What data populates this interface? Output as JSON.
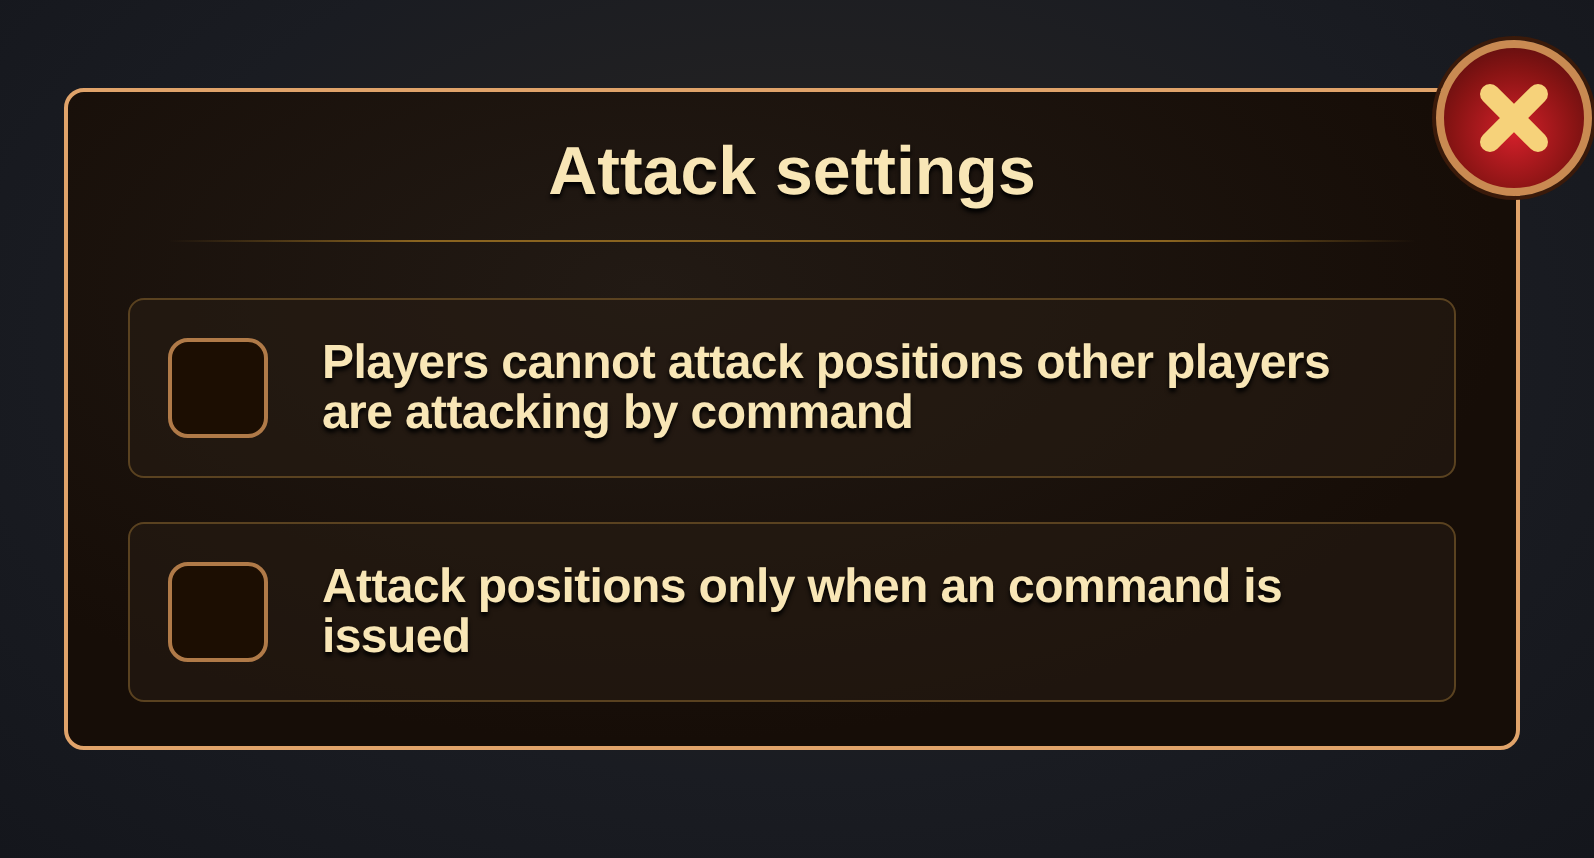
{
  "dialog": {
    "title": "Attack settings",
    "options": [
      {
        "label": "Players cannot attack positions other players are attacking by command",
        "checked": false
      },
      {
        "label": "Attack positions only when an command is issued",
        "checked": false
      }
    ]
  }
}
